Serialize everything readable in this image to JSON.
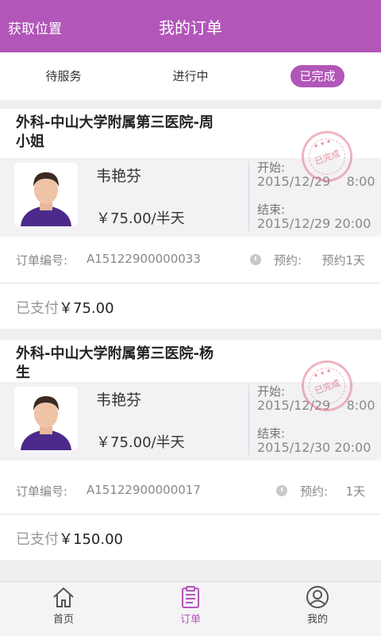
{
  "header": {
    "left_action": "获取位置",
    "title": "我的订单"
  },
  "tabs": [
    {
      "label": "待服务",
      "active": false
    },
    {
      "label": "进行中",
      "active": false
    },
    {
      "label": "已完成",
      "active": true
    }
  ],
  "orders": [
    {
      "title": "外科-中山大学附属第三医院-周小姐",
      "caregiver": "韦艳芬",
      "price": "￥75.00/半天",
      "start_label": "开始:",
      "start": "2015/12/29    8:00",
      "end_label": "结束:",
      "end": "2015/12/29 20:00",
      "status_stamp": "已完成",
      "order_no_label": "订单编号:",
      "order_no": "A15122900000033",
      "reserve_label": "预约:",
      "reserve": "预约1天",
      "paid_label": "已支付",
      "paid_amount": "￥75.00"
    },
    {
      "title": "外科-中山大学附属第三医院-杨生",
      "caregiver": "韦艳芬",
      "price": "￥75.00/半天",
      "start_label": "开始:",
      "start": "2015/12/29    8:00",
      "end_label": "结束:",
      "end": "2015/12/30 20:00",
      "status_stamp": "已完成",
      "order_no_label": "订单编号:",
      "order_no": "A15122900000017",
      "reserve_label": "预约:",
      "reserve": "1天",
      "paid_label": "已支付",
      "paid_amount": "￥150.00"
    }
  ],
  "bottom_nav": [
    {
      "label": "首页",
      "icon": "home-icon",
      "active": false
    },
    {
      "label": "订单",
      "icon": "clipboard-icon",
      "active": true
    },
    {
      "label": "我的",
      "icon": "user-icon",
      "active": false
    }
  ],
  "colors": {
    "accent": "#b256b9",
    "stamp": "#e2788c"
  }
}
